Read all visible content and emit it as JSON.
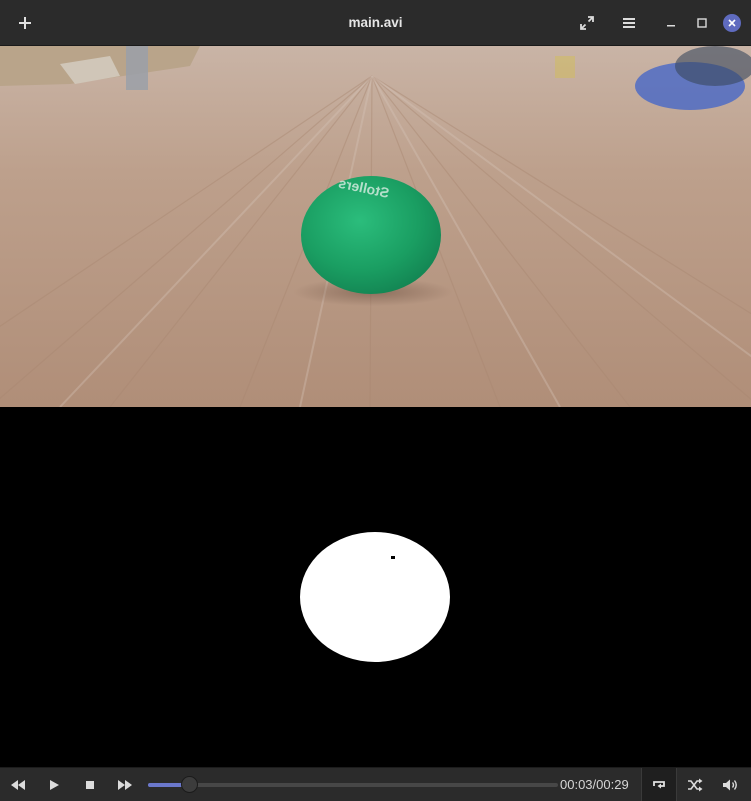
{
  "window": {
    "title": "main.avi",
    "accent": "#5f6bbf"
  },
  "header": {
    "add_icon": "plus-icon",
    "fullscreen_icon": "fullscreen-arrows-icon",
    "menu_icon": "hamburger-menu-icon",
    "minimize_icon": "minimize-icon",
    "maximize_icon": "maximize-icon",
    "close_icon": "close-icon"
  },
  "video": {
    "top_frame": {
      "ball_color": "#1fa36a",
      "ball_text": "Stollers",
      "floor_color": "#b69680"
    },
    "bottom_frame": {
      "mask_color": "#ffffff",
      "background": "#000000"
    }
  },
  "playback": {
    "elapsed": "00:03",
    "separator": "/",
    "duration": "00:29",
    "progress_fraction": 0.1,
    "repeat_active": true
  }
}
